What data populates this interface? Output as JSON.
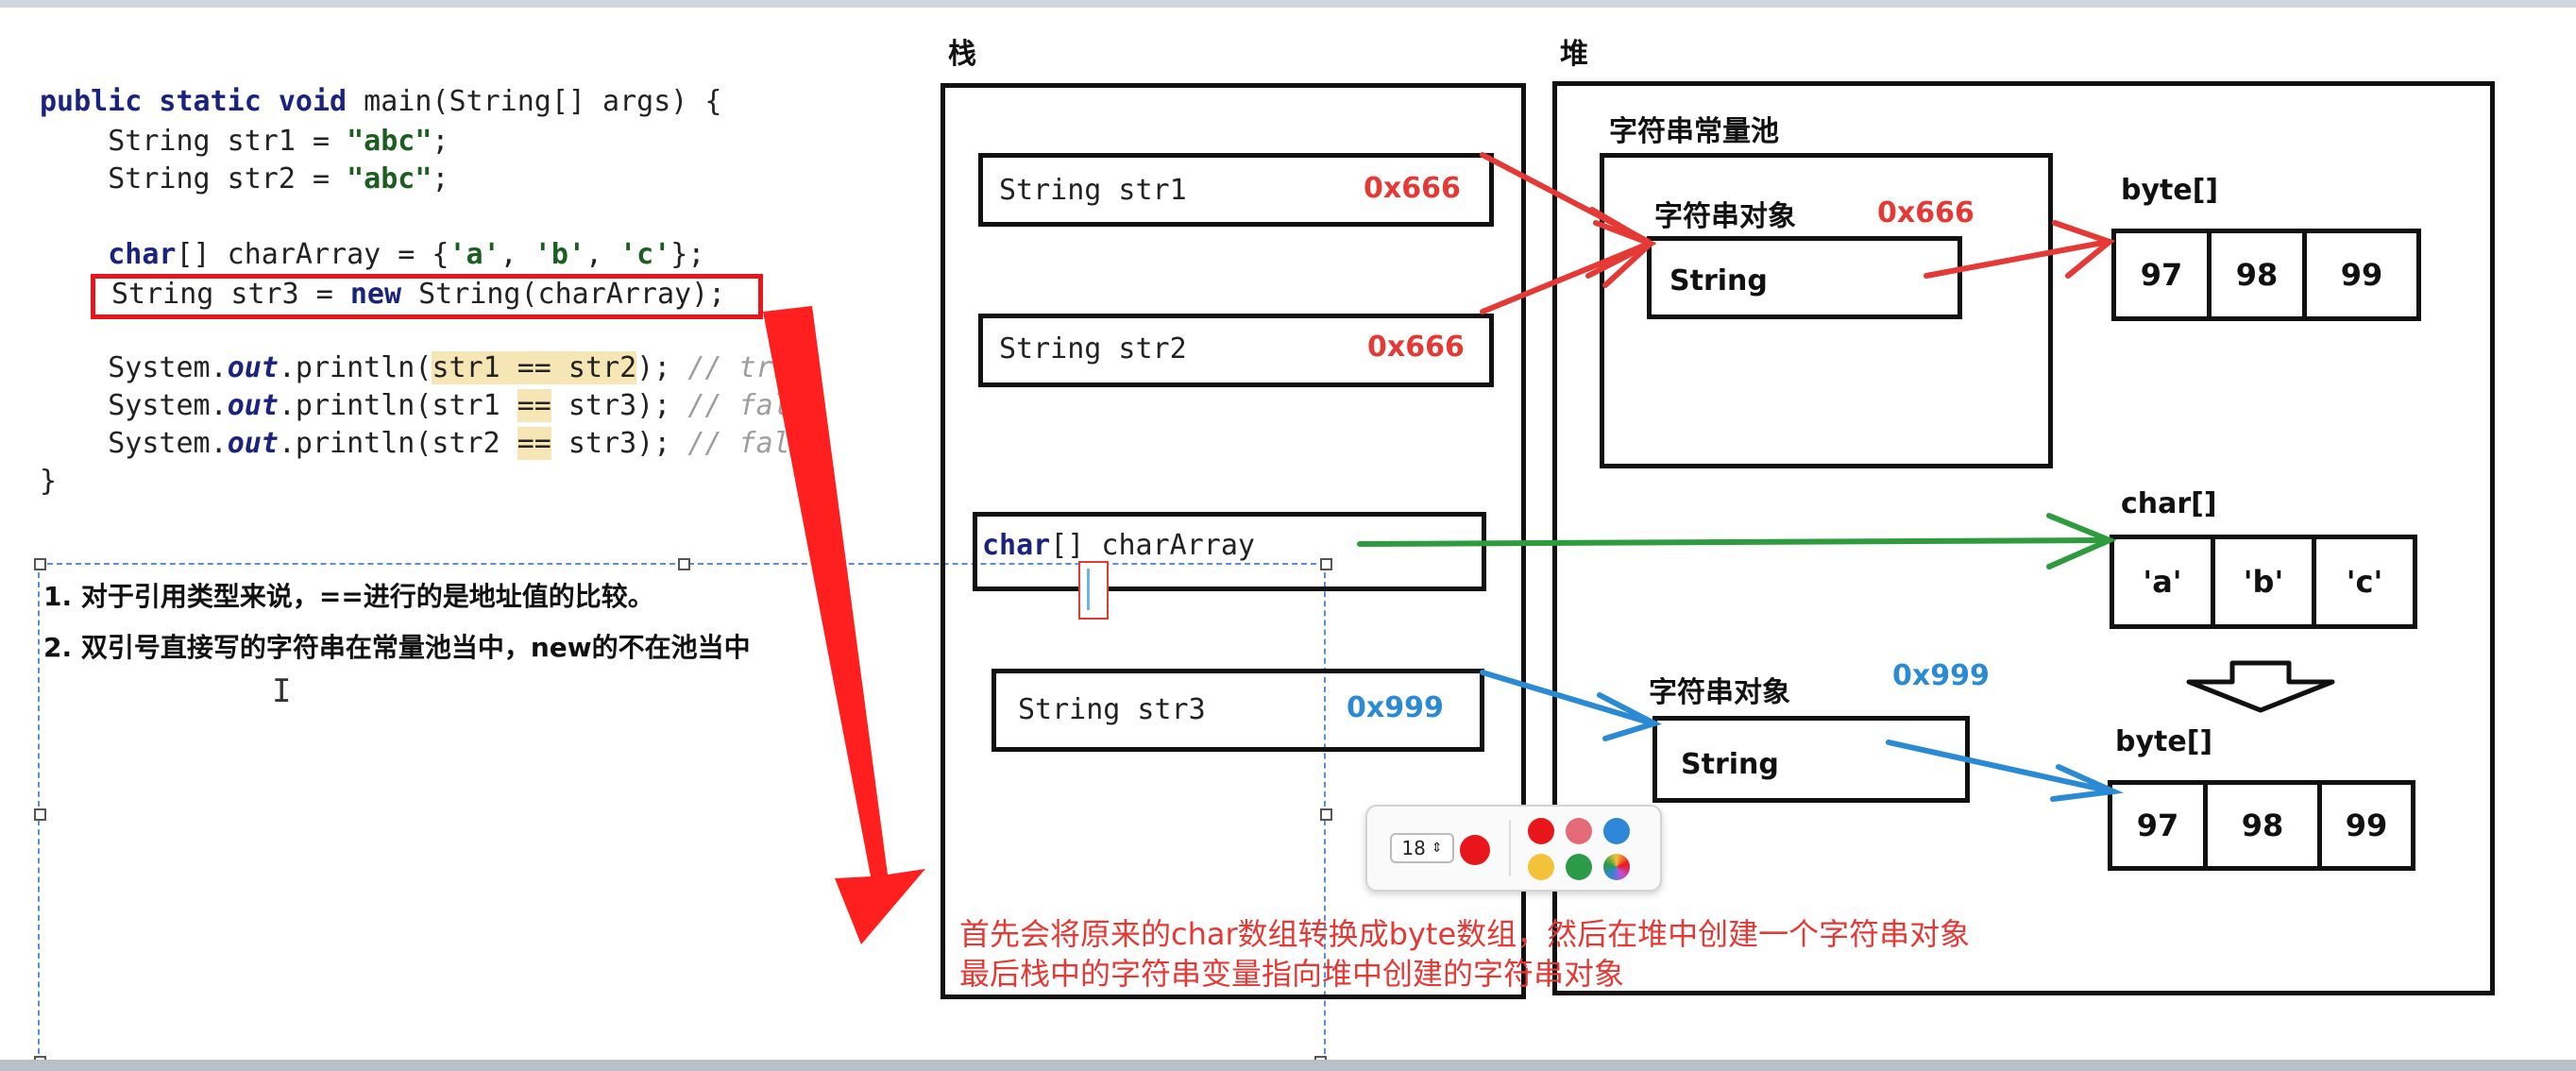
{
  "code": {
    "line1": {
      "kw": "public static void",
      "rest": " main(String[] args) {"
    },
    "line2": {
      "pre": "    String str1 = ",
      "lit": "\"abc\"",
      "end": ";"
    },
    "line3": {
      "pre": "    String str2 = ",
      "lit": "\"abc\"",
      "end": ";"
    },
    "line4": {
      "kw": "char",
      "pre": "[] charArray = {",
      "a": "'a'",
      "c1": ", ",
      "b": "'b'",
      "c2": ", ",
      "c": "'c'",
      "end": "};"
    },
    "line5": {
      "pre": "String str3 = ",
      "kw": "new",
      "end": " String(charArray);"
    },
    "line6": {
      "pre": "    System.",
      "out": "out",
      "mid": ".println(",
      "hl": "str1 == str2",
      "end": "); ",
      "cm": "// true"
    },
    "line7": {
      "pre": "    System.",
      "out": "out",
      "mid": ".println(str1 ",
      "hl": "==",
      "end": " str3); ",
      "cm": "// false"
    },
    "line8": {
      "pre": "    System.",
      "out": "out",
      "mid": ".println(str2 ",
      "hl": "==",
      "end": " str3); ",
      "cm": "// false"
    },
    "line9": "}"
  },
  "notes": [
    "1. 对于引用类型来说，==进行的是地址值的比较。",
    "2. 双引号直接写的字符串在常量池当中，new的不在池当中"
  ],
  "stack": {
    "label": "栈",
    "str1": {
      "label": "String str1",
      "addr": "0x666"
    },
    "str2": {
      "label": "String str2",
      "addr": "0x666"
    },
    "charArray": {
      "kw": "char",
      "label": "[] charArray"
    },
    "str3": {
      "label": "String str3",
      "addr": "0x999"
    }
  },
  "heap": {
    "label": "堆",
    "pool_label": "字符串常量池",
    "pool_object": {
      "label": "字符串对象",
      "addr": "0x666",
      "type": "String"
    },
    "byte_array_1": {
      "label": "byte[]",
      "values": [
        "97",
        "98",
        "99"
      ]
    },
    "char_array": {
      "label": "char[]",
      "values": [
        "'a'",
        "'b'",
        "'c'"
      ]
    },
    "new_object": {
      "label": "字符串对象",
      "addr": "0x999",
      "type": "String"
    },
    "byte_array_2": {
      "label": "byte[]",
      "values": [
        "97",
        "98",
        "99"
      ]
    }
  },
  "caption": [
    "首先会将原来的char数组转换成byte数组，然后在堆中创建一个字符串对象",
    "最后栈中的字符串变量指向堆中创建的字符串对象"
  ],
  "toolbar": {
    "font_size": "18",
    "colors": {
      "red": "#e8161b",
      "pink": "#e56a78",
      "blue": "#2d87d6",
      "yellow": "#f4c23a",
      "green": "#2c9b49"
    }
  },
  "colors": {
    "pointer_red": "#e53935",
    "pointer_blue": "#2b8ad4",
    "pointer_green": "#2e9b3e"
  }
}
